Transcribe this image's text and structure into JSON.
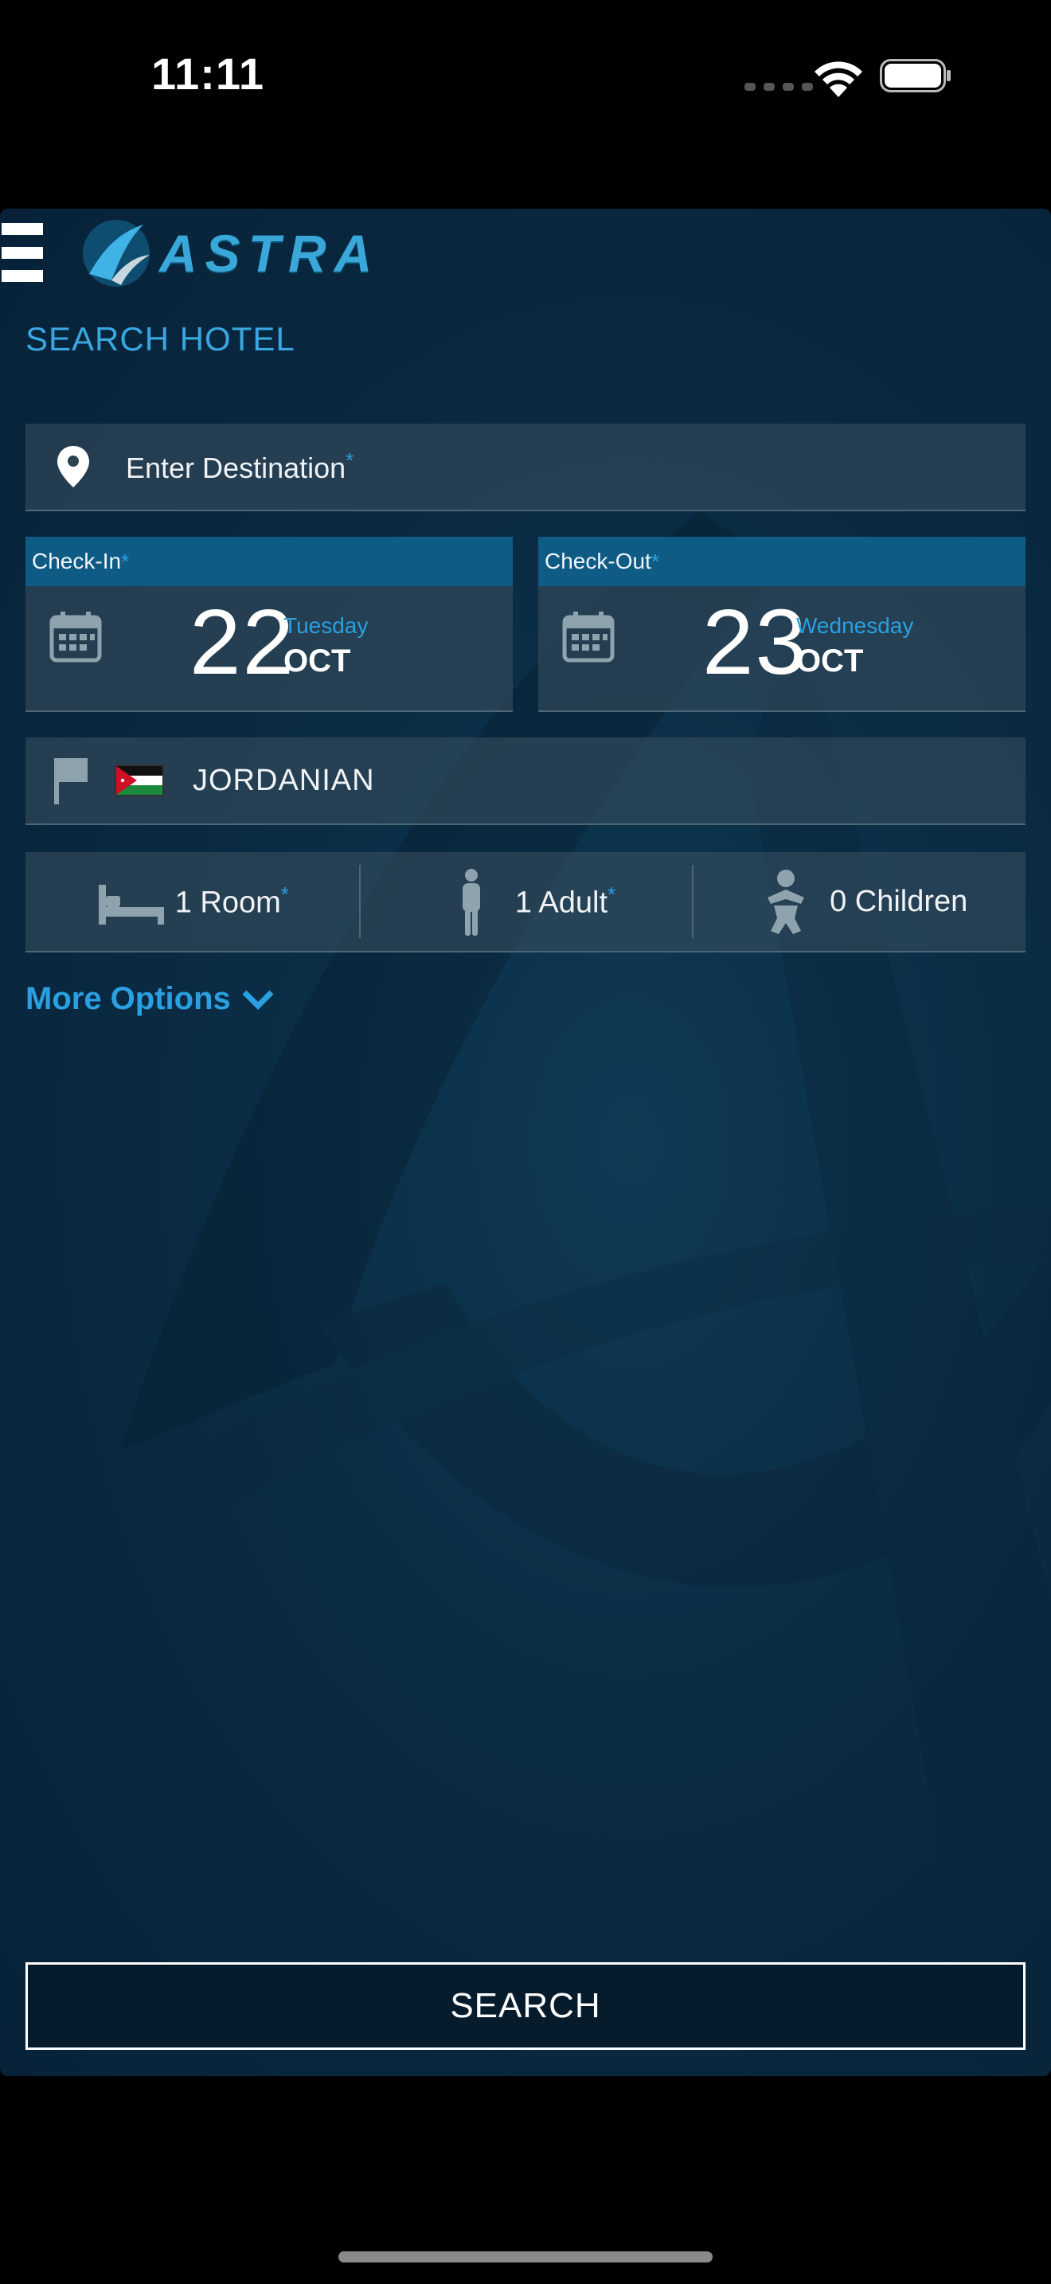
{
  "status_bar": {
    "time": "11:11"
  },
  "header": {
    "logo_text": "ASTRA"
  },
  "page": {
    "title": "SEARCH HOTEL"
  },
  "destination": {
    "placeholder": "Enter Destination",
    "required_mark": "*"
  },
  "check_in": {
    "label": "Check-In",
    "required_mark": "*",
    "day": "22",
    "weekday": "Tuesday",
    "month": "OCT"
  },
  "check_out": {
    "label": "Check-Out",
    "required_mark": "*",
    "day": "23",
    "weekday": "Wednesday",
    "month": "OCT"
  },
  "nationality": {
    "value": "JORDANIAN"
  },
  "guests": {
    "rooms": {
      "label": "1 Room",
      "required_mark": "*"
    },
    "adults": {
      "label": "1 Adult",
      "required_mark": "*"
    },
    "children": {
      "label": "0 Children"
    }
  },
  "more_options": {
    "label": "More Options"
  },
  "search_button": {
    "label": "SEARCH"
  },
  "colors": {
    "accent": "#2aa0e0",
    "header_bar": "#0e5b86",
    "background": "#0a2c44"
  }
}
